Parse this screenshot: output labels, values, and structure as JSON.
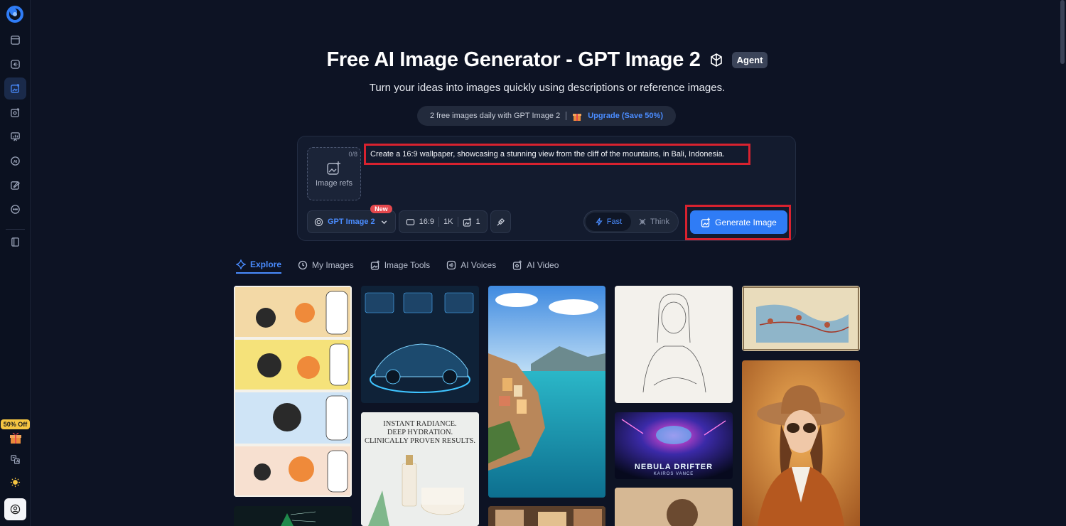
{
  "header": {
    "title": "Free AI Image Generator - GPT Image 2",
    "agent_badge": "Agent",
    "subtitle": "Turn your ideas into images quickly using descriptions or reference images.",
    "quota_text": "2 free images daily with GPT Image 2",
    "upgrade_link": "Upgrade (Save 50%)"
  },
  "prompt": {
    "ref_count": "0/8",
    "image_refs_label": "Image refs",
    "text": "Create a 16:9 wallpaper, showcasing a stunning view from the cliff of the mountains, in Bali, Indonesia."
  },
  "toolbar": {
    "model": "GPT Image 2",
    "new_badge": "New",
    "aspect": "16:9",
    "resolution": "1K",
    "count": "1",
    "mode_fast": "Fast",
    "mode_think": "Think",
    "generate": "Generate Image"
  },
  "tabs": [
    {
      "label": "Explore"
    },
    {
      "label": "My Images"
    },
    {
      "label": "Image Tools"
    },
    {
      "label": "AI Voices"
    },
    {
      "label": "AI Video"
    }
  ],
  "sidebar": {
    "promo": "50% Off"
  },
  "gallery": {
    "skincare_lines": [
      "INSTANT RADIANCE.",
      "DEEP HYDRATION.",
      "CLINICALLY PROVEN RESULTS."
    ],
    "game_title": "NEBULA DRIFTER",
    "game_subtitle": "KAIROS VANCE"
  },
  "colors": {
    "accent": "#2f7cf6",
    "highlight_box": "#d8222f",
    "background": "#0d1324"
  }
}
